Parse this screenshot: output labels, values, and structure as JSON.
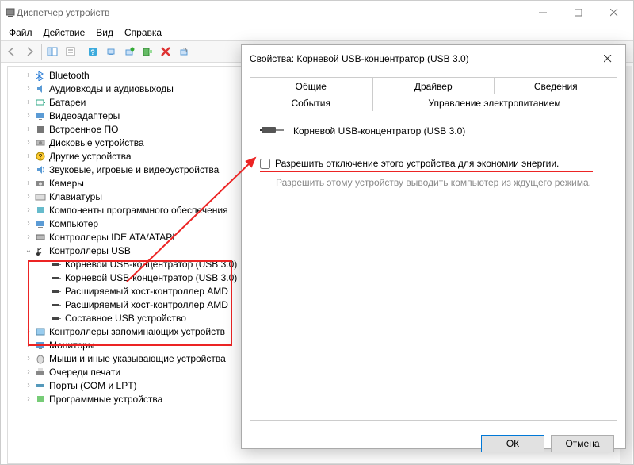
{
  "main_window": {
    "title": "Диспетчер устройств",
    "menu": {
      "file": "Файл",
      "action": "Действие",
      "view": "Вид",
      "help": "Справка"
    }
  },
  "tree": {
    "items": [
      {
        "label": "Bluetooth",
        "icon": "bluetooth"
      },
      {
        "label": "Аудиовходы и аудиовыходы",
        "icon": "audio"
      },
      {
        "label": "Батареи",
        "icon": "battery"
      },
      {
        "label": "Видеоадаптеры",
        "icon": "display"
      },
      {
        "label": "Встроенное ПО",
        "icon": "firmware"
      },
      {
        "label": "Дисковые устройства",
        "icon": "disk"
      },
      {
        "label": "Другие устройства",
        "icon": "other"
      },
      {
        "label": "Звуковые, игровые и видеоустройства",
        "icon": "sound"
      },
      {
        "label": "Камеры",
        "icon": "camera"
      },
      {
        "label": "Клавиатуры",
        "icon": "keyboard"
      },
      {
        "label": "Компоненты программного обеспечения",
        "icon": "software"
      },
      {
        "label": "Компьютер",
        "icon": "computer"
      },
      {
        "label": "Контроллеры IDE ATA/ATAPI",
        "icon": "ide"
      }
    ],
    "usb_section": {
      "label": "Контроллеры USB"
    },
    "usb_children": [
      {
        "label": "Корневой USB-концентратор (USB 3.0)"
      },
      {
        "label": "Корневой USB-концентратор (USB 3.0)"
      },
      {
        "label": "Расширяемый хост-контроллер AMD"
      },
      {
        "label": "Расширяемый хост-контроллер AMD"
      },
      {
        "label": "Составное USB устройство"
      }
    ],
    "items_after": [
      {
        "label": "Контроллеры запоминающих устройств",
        "icon": "storage"
      },
      {
        "label": "Мониторы",
        "icon": "monitor"
      },
      {
        "label": "Мыши и иные указывающие устройства",
        "icon": "mouse"
      },
      {
        "label": "Очереди печати",
        "icon": "printer"
      },
      {
        "label": "Порты (COM и LPT)",
        "icon": "port"
      },
      {
        "label": "Программные устройства",
        "icon": "softdev"
      }
    ]
  },
  "dialog": {
    "title": "Свойства: Корневой USB-концентратор (USB 3.0)",
    "tabs": {
      "general": "Общие",
      "driver": "Драйвер",
      "details": "Сведения",
      "events": "События",
      "power": "Управление электропитанием"
    },
    "device_name": "Корневой USB-концентратор (USB 3.0)",
    "checkbox_label": "Разрешить отключение этого устройства для экономии энергии.",
    "disabled_label": "Разрешить этому устройству выводить компьютер из ждущего режима.",
    "buttons": {
      "ok": "ОК",
      "cancel": "Отмена"
    }
  }
}
